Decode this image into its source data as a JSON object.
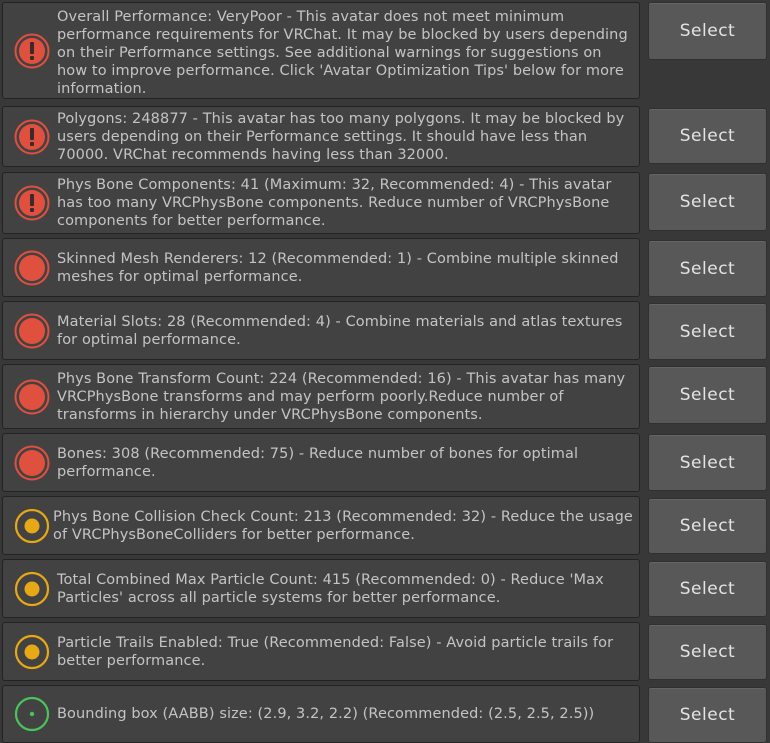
{
  "colors": {
    "error": "#e0503f",
    "warning": "#e6a817",
    "ok": "#4cc35a"
  },
  "rows": [
    {
      "severity": "error",
      "icon": "error-exclamation-icon",
      "message": "Overall Performance: VeryPoor - This avatar does not meet minimum performance requirements for VRChat. It may be blocked by users depending on their Performance settings. See additional warnings for suggestions on how to improve performance. Click 'Avatar Optimization Tips' below for more information.",
      "button": "Select"
    },
    {
      "severity": "error",
      "icon": "error-exclamation-icon",
      "message": "Polygons: 248877 - This avatar has too many polygons. It may be blocked by users depending on their Performance settings. It should have less than 70000. VRChat recommends having less than 32000.",
      "button": "Select"
    },
    {
      "severity": "error",
      "icon": "error-exclamation-icon",
      "message": "Phys Bone Components: 41 (Maximum: 32, Recommended: 4) - This avatar has too many VRCPhysBone components. Reduce number of VRCPhysBone components for better performance.",
      "button": "Select"
    },
    {
      "severity": "poor",
      "icon": "red-circle-icon",
      "message": "Skinned Mesh Renderers: 12 (Recommended: 1) - Combine multiple skinned meshes for optimal performance.",
      "button": "Select"
    },
    {
      "severity": "poor",
      "icon": "red-circle-icon",
      "message": "Material Slots: 28 (Recommended: 4) - Combine materials and atlas textures for optimal performance.",
      "button": "Select"
    },
    {
      "severity": "poor",
      "icon": "red-circle-icon",
      "message": "Phys Bone Transform Count: 224 (Recommended: 16) - This avatar has many VRCPhysBone transforms and may perform poorly.Reduce number of transforms in hierarchy under VRCPhysBone components.",
      "button": "Select"
    },
    {
      "severity": "poor",
      "icon": "red-circle-icon",
      "message": "Bones: 308 (Recommended: 75) - Reduce number of bones for optimal performance.",
      "button": "Select"
    },
    {
      "severity": "medium",
      "icon": "yellow-circle-icon",
      "message": "Phys Bone Collision Check Count: 213 (Recommended: 32) - Reduce the usage of VRCPhysBoneColliders for better performance.",
      "button": "Select"
    },
    {
      "severity": "medium",
      "icon": "yellow-circle-icon",
      "message": "Total Combined Max Particle Count: 415 (Recommended: 0) - Reduce 'Max Particles' across all particle systems for better performance.",
      "button": "Select"
    },
    {
      "severity": "medium",
      "icon": "yellow-circle-icon",
      "message": "Particle Trails Enabled: True (Recommended: False) - Avoid particle trails for better performance.",
      "button": "Select"
    },
    {
      "severity": "good",
      "icon": "green-circle-icon",
      "message": "Bounding box (AABB) size: (2.9, 3.2, 2.2) (Recommended: (2.5, 2.5, 2.5))",
      "button": "Select"
    }
  ]
}
